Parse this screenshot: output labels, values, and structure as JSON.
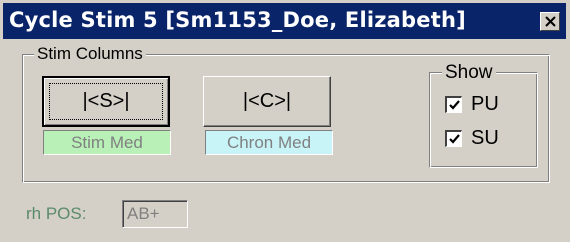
{
  "window": {
    "title": "Cycle Stim 5  [Sm1153_Doe, Elizabeth]",
    "close_icon": "close-icon"
  },
  "stim_columns": {
    "legend": "Stim Columns",
    "stim_button_label": "|<S>|",
    "chron_button_label": "|<C>|",
    "stim_med_label": "Stim Med",
    "chron_med_label": "Chron Med",
    "stim_med_color": "#b8f0b8",
    "chron_med_color": "#c8f4f8"
  },
  "show": {
    "legend": "Show",
    "pu_label": "PU",
    "pu_checked": true,
    "su_label": "SU",
    "su_checked": true
  },
  "rh": {
    "label": "rh POS:",
    "value": "AB+"
  }
}
